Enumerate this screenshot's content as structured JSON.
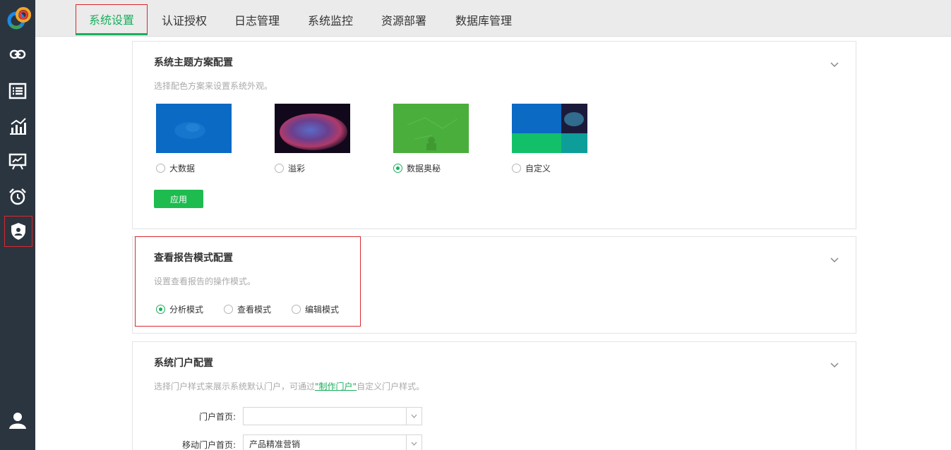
{
  "sidebar": {
    "items": [
      {
        "icon": "link-icon"
      },
      {
        "icon": "list-icon"
      },
      {
        "icon": "bar-chart-icon"
      },
      {
        "icon": "presentation-icon"
      },
      {
        "icon": "alarm-clock-icon"
      },
      {
        "icon": "shield-user-icon"
      },
      {
        "icon": "user-icon"
      }
    ]
  },
  "tabs": [
    {
      "label": "系统设置",
      "active": true
    },
    {
      "label": "认证授权"
    },
    {
      "label": "日志管理"
    },
    {
      "label": "系统监控"
    },
    {
      "label": "资源部署"
    },
    {
      "label": "数据库管理"
    }
  ],
  "theme": {
    "title": "系统主题方案配置",
    "desc": "选择配色方案来设置系统外观。",
    "options": [
      {
        "label": "大数据",
        "checked": false
      },
      {
        "label": "溢彩",
        "checked": false
      },
      {
        "label": "数据奥秘",
        "checked": true
      },
      {
        "label": "自定义",
        "checked": false
      }
    ],
    "apply_label": "应用"
  },
  "report": {
    "title": "查看报告模式配置",
    "desc": "设置查看报告的操作模式。",
    "options": [
      {
        "label": "分析模式",
        "checked": true
      },
      {
        "label": "查看模式",
        "checked": false
      },
      {
        "label": "编辑模式",
        "checked": false
      }
    ]
  },
  "portal": {
    "title": "系统门户配置",
    "desc_prefix": "选择门户样式来展示系统默认门户，可通过",
    "desc_link": "\"制作门户\"",
    "desc_suffix": "自定义门户样式。",
    "home_label": "门户首页:",
    "home_value": "",
    "mobile_label": "移动门户首页:",
    "mobile_value": "产品精准营销"
  },
  "colors": {
    "accent": "#1aaf5d",
    "sidebar_bg": "#2b3540",
    "highlight": "#d9282f"
  }
}
